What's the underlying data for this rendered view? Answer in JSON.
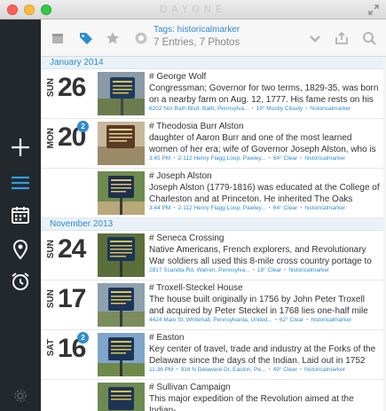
{
  "app_title": "DAYONE",
  "toolbar": {
    "tag_title": "Tags: historicalmarker",
    "tag_sub": "7 Entries, 7 Photos"
  },
  "icons": {
    "sidebar": [
      "plus-icon",
      "menu-icon",
      "calendar-icon",
      "map-pin-icon",
      "alarm-clock-icon",
      "gear-icon"
    ],
    "toolbar": [
      "journal-icon",
      "tag-icon",
      "star-icon",
      "weather-icon",
      "chevron-down-icon",
      "share-icon",
      "search-icon"
    ]
  },
  "colors": {
    "accent": "#2e8ccf",
    "sidebar": "#23282d"
  },
  "months": [
    {
      "label": "January 2014",
      "entries": [
        {
          "dow": "SUN",
          "day": "26",
          "badge": "",
          "title": "# George Wolf",
          "body": "Congressman; Governor for two terms, 1829-35, was born on a nearby farm on Aug. 12, 1777. His fame rests on his suppo...",
          "location": "6202 Nor Bath Blvd, Bath, Pennsylva...",
          "weather": "19° Mostly Cloudy",
          "tag": "historicalmarker",
          "time": ""
        },
        {
          "dow": "MON",
          "day": "20",
          "badge": "2",
          "title": "# Theodosia Burr Alston",
          "body": "daughter of Aaron Burr and one of the most learned women of her era; wife of Governor Joseph Alston, who is buried w...",
          "time": "3:45 PM",
          "location": "2-112 Henry Flagg Loop, Pawley...",
          "weather": "64° Clear",
          "tag": "historicalmarker"
        },
        {
          "dow": "",
          "day": "",
          "badge": "",
          "title": "# Joseph Alston",
          "body": "Joseph Alston (1779-1816) was educated at the College of Charleston and at Princeton. He inherited The Oaks Plantat...",
          "time": "3:44 PM",
          "location": "2-112 Henry Flagg Loop, Pawley...",
          "weather": "64° Clear",
          "tag": "historicalmarker"
        }
      ]
    },
    {
      "label": "November 2013",
      "entries": [
        {
          "dow": "SUN",
          "day": "24",
          "badge": "",
          "title": "# Seneca Crossing",
          "body": "Native Americans, French explorers, and Revolutionary War soldiers all used this 8-mile cross country portage to acces...",
          "time": "",
          "location": "2817 Scandia Rd, Warren, Pennsylva...",
          "weather": "19° Clear",
          "tag": "historicalmarker"
        },
        {
          "dow": "SUN",
          "day": "17",
          "badge": "",
          "title": "# Troxell-Steckel House",
          "body": "The house built originally in 1756 by John Peter Troxell and acquired by Peter Steckel in 1768 lies one-half mile west. R...",
          "time": "",
          "location": "4424 Main St, Whitehall, Pennsylvania, United...",
          "weather": "62° Clear",
          "tag": "historicalmarker"
        },
        {
          "dow": "SAT",
          "day": "16",
          "badge": "2",
          "title": "# Easton",
          "body": "Key center of travel, trade and industry at the Forks of the Delaware since the days of the Indian. Laid out in 1752 by...",
          "time": "11:36 PM",
          "location": "916 N Delaware Dr, Easton, Pe...",
          "weather": "49° Clear",
          "tag": "historicalmarker"
        },
        {
          "dow": "",
          "day": "",
          "badge": "",
          "title": "# Sullivan Campaign",
          "body": "This major expedition of the Revolution aimed at the Indian-",
          "time": "",
          "location": "",
          "weather": "",
          "tag": ""
        }
      ]
    }
  ]
}
